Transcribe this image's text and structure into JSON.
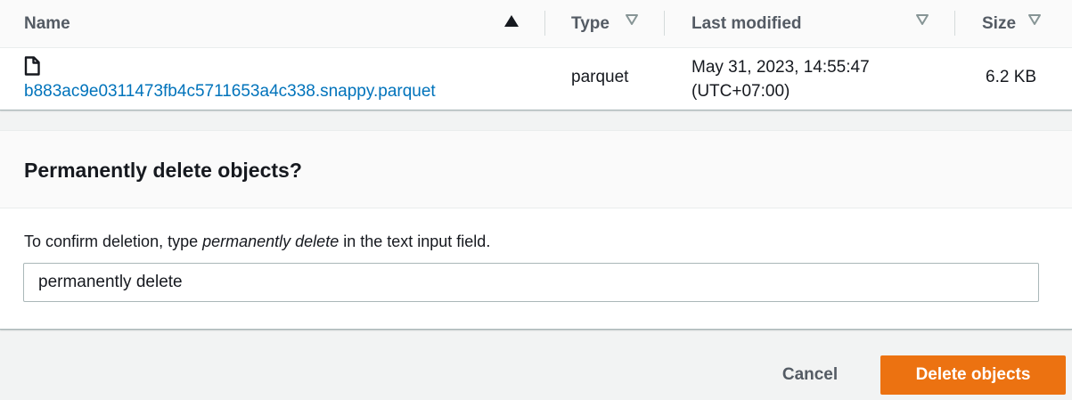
{
  "colors": {
    "link": "#0073bb",
    "primary_button": "#ec7211",
    "header_text": "#545b64",
    "body_text": "#16191f",
    "page_background": "#f2f3f3"
  },
  "table": {
    "columns": [
      {
        "label": "Name",
        "sort_icon": "sort-ascending-icon"
      },
      {
        "label": "Type",
        "sort_icon": "sort-icon"
      },
      {
        "label": "Last modified",
        "sort_icon": "sort-icon"
      },
      {
        "label": "Size",
        "sort_icon": "sort-icon"
      }
    ],
    "rows": [
      {
        "icon": "file-icon",
        "name": "b883ac9e0311473fb4c5711653a4c338.snappy.parquet",
        "type": "parquet",
        "last_modified_line1": "May 31, 2023, 14:55:47",
        "last_modified_line2": "(UTC+07:00)",
        "size": "6.2 KB"
      }
    ]
  },
  "confirm": {
    "title": "Permanently delete objects?",
    "instruction_prefix": "To confirm deletion, type ",
    "instruction_keyword": "permanently delete",
    "instruction_suffix": " in the text input field.",
    "input_value": "permanently delete"
  },
  "footer": {
    "cancel_label": "Cancel",
    "delete_label": "Delete objects"
  }
}
